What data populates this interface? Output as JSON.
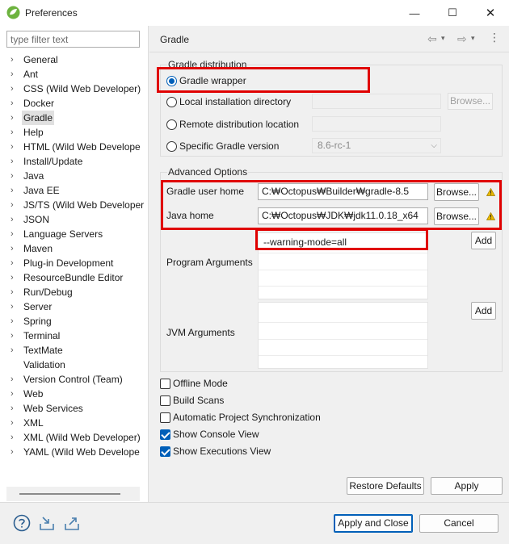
{
  "window": {
    "title": "Preferences",
    "controls": {
      "minimize": "—",
      "maximize": "☐",
      "close": "✕"
    }
  },
  "sidebar": {
    "filter_placeholder": "type filter text",
    "items": [
      {
        "label": "General",
        "expandable": true
      },
      {
        "label": "Ant",
        "expandable": true
      },
      {
        "label": "CSS (Wild Web Developer)",
        "expandable": true
      },
      {
        "label": "Docker",
        "expandable": true
      },
      {
        "label": "Gradle",
        "expandable": true,
        "selected": true
      },
      {
        "label": "Help",
        "expandable": true
      },
      {
        "label": "HTML (Wild Web Develope",
        "expandable": true
      },
      {
        "label": "Install/Update",
        "expandable": true
      },
      {
        "label": "Java",
        "expandable": true
      },
      {
        "label": "Java EE",
        "expandable": true
      },
      {
        "label": "JS/TS (Wild Web Developer",
        "expandable": true
      },
      {
        "label": "JSON",
        "expandable": true
      },
      {
        "label": "Language Servers",
        "expandable": true
      },
      {
        "label": "Maven",
        "expandable": true
      },
      {
        "label": "Plug-in Development",
        "expandable": true
      },
      {
        "label": "ResourceBundle Editor",
        "expandable": true
      },
      {
        "label": "Run/Debug",
        "expandable": true
      },
      {
        "label": "Server",
        "expandable": true
      },
      {
        "label": "Spring",
        "expandable": true
      },
      {
        "label": "Terminal",
        "expandable": true
      },
      {
        "label": "TextMate",
        "expandable": true
      },
      {
        "label": "Validation",
        "expandable": false
      },
      {
        "label": "Version Control (Team)",
        "expandable": true
      },
      {
        "label": "Web",
        "expandable": true
      },
      {
        "label": "Web Services",
        "expandable": true
      },
      {
        "label": "XML",
        "expandable": true
      },
      {
        "label": "XML (Wild Web Developer)",
        "expandable": true
      },
      {
        "label": "YAML (Wild Web Develope",
        "expandable": true
      }
    ]
  },
  "page": {
    "title": "Gradle",
    "nav": {
      "back": "⇦",
      "forward": "⇨",
      "dropdown": "▾",
      "menu": "⋮"
    }
  },
  "distribution": {
    "group_title": "Gradle distribution",
    "wrapper_label": "Gradle wrapper",
    "local_label": "Local installation directory",
    "local_value": "",
    "browse_label": "Browse...",
    "remote_label": "Remote distribution location",
    "remote_value": "",
    "version_label": "Specific Gradle version",
    "version_value": "8.6-rc-1",
    "selected": "Gradle wrapper"
  },
  "advanced": {
    "group_title": "Advanced Options",
    "user_home_label": "Gradle user home",
    "user_home_value": "C:₩Octopus₩Builder₩gradle-8.5",
    "java_home_label": "Java home",
    "java_home_value": "C:₩Octopus₩JDK₩jdk11.0.18_x64",
    "browse_label": "Browse...",
    "program_args_label": "Program Arguments",
    "program_args": [
      "--warning-mode=all"
    ],
    "jvm_args_label": "JVM Arguments",
    "jvm_args": [],
    "add_label": "Add"
  },
  "options": {
    "offline_mode": {
      "label": "Offline Mode",
      "checked": false
    },
    "build_scans": {
      "label": "Build Scans",
      "checked": false
    },
    "auto_sync": {
      "label": "Automatic Project Synchronization",
      "checked": false
    },
    "show_console": {
      "label": "Show Console View",
      "checked": true
    },
    "show_executions": {
      "label": "Show Executions View",
      "checked": true
    }
  },
  "page_buttons": {
    "restore_defaults": "Restore Defaults",
    "apply": "Apply"
  },
  "dialog_buttons": {
    "apply_and_close": "Apply and Close",
    "cancel": "Cancel"
  },
  "colors": {
    "highlight": "#e00000",
    "accent": "#005fb8",
    "warning": "#e8b800",
    "app_icon": "#6db33f"
  }
}
